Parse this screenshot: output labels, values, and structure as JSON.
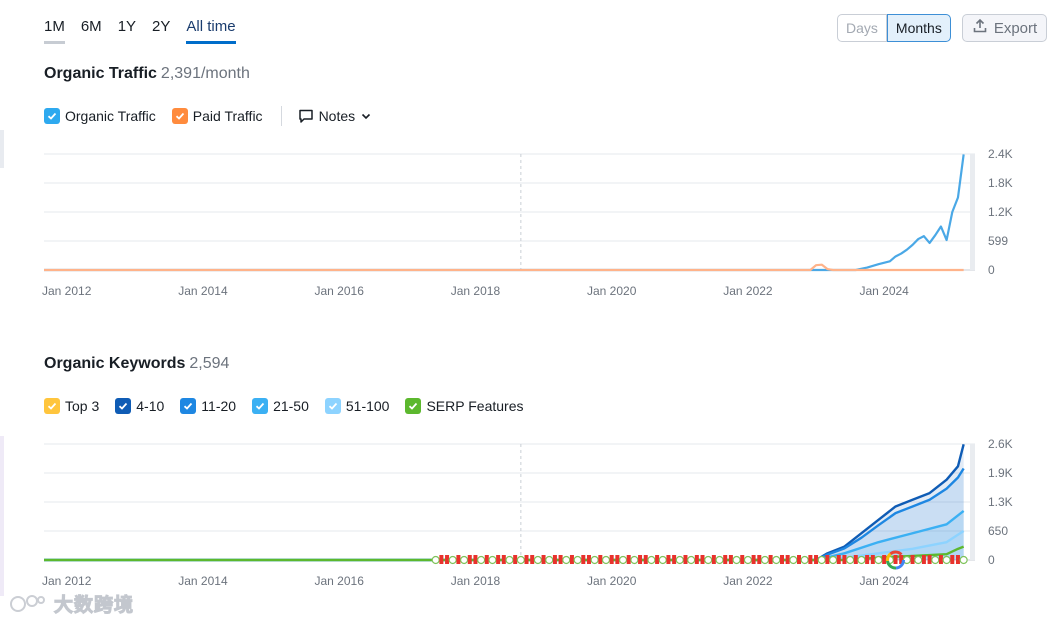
{
  "ranges": [
    "1M",
    "6M",
    "1Y",
    "2Y",
    "All time"
  ],
  "active_range": "All time",
  "granularity": {
    "days": "Days",
    "months": "Months",
    "active": "Months"
  },
  "export_label": "Export",
  "traffic": {
    "title": "Organic Traffic",
    "value": "2,391/month",
    "legend": [
      {
        "label": "Organic Traffic",
        "color": "#2ea9ef"
      },
      {
        "label": "Paid Traffic",
        "color": "#ff8b3d"
      }
    ],
    "notes_label": "Notes"
  },
  "keywords": {
    "title": "Organic Keywords",
    "value": "2,594",
    "legend": [
      {
        "label": "Top 3",
        "color": "#ffc53d"
      },
      {
        "label": "4-10",
        "color": "#0f5cb5"
      },
      {
        "label": "11-20",
        "color": "#1e87e2"
      },
      {
        "label": "21-50",
        "color": "#3bb0f3"
      },
      {
        "label": "51-100",
        "color": "#8dd3ff"
      },
      {
        "label": "SERP Features",
        "color": "#5cb82e"
      }
    ]
  },
  "watermark": "大数跨境",
  "chart_data": [
    {
      "type": "line",
      "title": "Organic Traffic",
      "x_ticks": [
        "Jan 2012",
        "Jan 2014",
        "Jan 2016",
        "Jan 2018",
        "Jan 2020",
        "Jan 2022",
        "Jan 2024"
      ],
      "y_ticks": [
        "0",
        "599",
        "1.2K",
        "1.8K",
        "2.4K"
      ],
      "ylim": [
        0,
        2400
      ],
      "xlim": [
        "2011-09",
        "2025-05"
      ],
      "grid": true,
      "series": [
        {
          "name": "Organic Traffic",
          "color": "#4aa8e6",
          "points": [
            [
              "2011-09",
              0
            ],
            [
              "2023-08",
              0
            ],
            [
              "2023-10",
              50
            ],
            [
              "2023-12",
              120
            ],
            [
              "2024-02",
              180
            ],
            [
              "2024-03",
              280
            ],
            [
              "2024-04",
              340
            ],
            [
              "2024-05",
              420
            ],
            [
              "2024-06",
              520
            ],
            [
              "2024-07",
              640
            ],
            [
              "2024-08",
              700
            ],
            [
              "2024-09",
              560
            ],
            [
              "2024-10",
              720
            ],
            [
              "2024-11",
              900
            ],
            [
              "2024-12",
              620
            ],
            [
              "2025-01",
              1200
            ],
            [
              "2025-02",
              1500
            ],
            [
              "2025-03",
              2391
            ]
          ]
        },
        {
          "name": "Paid Traffic",
          "color": "#ffb38a",
          "points": [
            [
              "2011-09",
              0
            ],
            [
              "2022-12",
              0
            ],
            [
              "2023-01",
              100
            ],
            [
              "2023-02",
              110
            ],
            [
              "2023-03",
              20
            ],
            [
              "2023-04",
              0
            ],
            [
              "2025-03",
              0
            ]
          ]
        }
      ]
    },
    {
      "type": "area",
      "title": "Organic Keywords",
      "x_ticks": [
        "Jan 2012",
        "Jan 2014",
        "Jan 2016",
        "Jan 2018",
        "Jan 2020",
        "Jan 2022",
        "Jan 2024"
      ],
      "y_ticks": [
        "0",
        "650",
        "1.3K",
        "1.9K",
        "2.6K"
      ],
      "ylim": [
        0,
        2600
      ],
      "xlim": [
        "2011-09",
        "2025-05"
      ],
      "grid": true,
      "series": [
        {
          "name": "4-10",
          "color": "#0f5cb5",
          "points": [
            [
              "2011-09",
              0
            ],
            [
              "2023-01",
              0
            ],
            [
              "2023-03",
              150
            ],
            [
              "2023-06",
              300
            ],
            [
              "2023-09",
              600
            ],
            [
              "2023-12",
              900
            ],
            [
              "2024-03",
              1200
            ],
            [
              "2024-06",
              1350
            ],
            [
              "2024-09",
              1500
            ],
            [
              "2024-12",
              1800
            ],
            [
              "2025-02",
              2100
            ],
            [
              "2025-03",
              2594
            ]
          ]
        },
        {
          "name": "11-20",
          "color": "#1e87e2",
          "points": [
            [
              "2011-09",
              0
            ],
            [
              "2023-01",
              0
            ],
            [
              "2023-03",
              120
            ],
            [
              "2023-06",
              260
            ],
            [
              "2023-09",
              500
            ],
            [
              "2023-12",
              780
            ],
            [
              "2024-03",
              1050
            ],
            [
              "2024-06",
              1200
            ],
            [
              "2024-09",
              1350
            ],
            [
              "2024-12",
              1600
            ],
            [
              "2025-02",
              1850
            ],
            [
              "2025-03",
              2050
            ]
          ]
        },
        {
          "name": "21-50",
          "color": "#3bb0f3",
          "points": [
            [
              "2011-09",
              0
            ],
            [
              "2023-01",
              0
            ],
            [
              "2023-06",
              150
            ],
            [
              "2023-12",
              400
            ],
            [
              "2024-06",
              600
            ],
            [
              "2024-12",
              800
            ],
            [
              "2025-03",
              1100
            ]
          ]
        },
        {
          "name": "51-100",
          "color": "#8dd3ff",
          "points": [
            [
              "2011-09",
              0
            ],
            [
              "2023-01",
              0
            ],
            [
              "2023-06",
              50
            ],
            [
              "2023-12",
              150
            ],
            [
              "2024-06",
              250
            ],
            [
              "2024-12",
              400
            ],
            [
              "2025-03",
              650
            ]
          ]
        },
        {
          "name": "SERP Features",
          "color": "#5cb82e",
          "points": [
            [
              "2011-09",
              0
            ],
            [
              "2023-06",
              0
            ],
            [
              "2024-01",
              60
            ],
            [
              "2024-06",
              90
            ],
            [
              "2024-12",
              130
            ],
            [
              "2025-02",
              250
            ],
            [
              "2025-03",
              300
            ]
          ]
        }
      ]
    }
  ]
}
